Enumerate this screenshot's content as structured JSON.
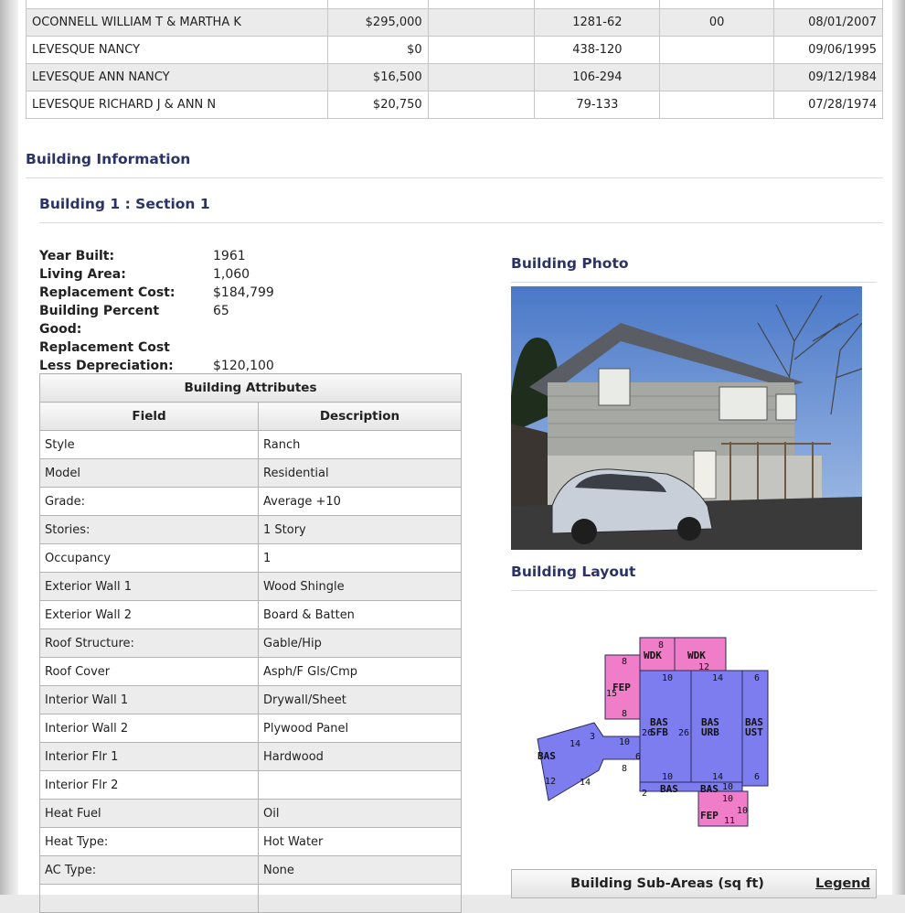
{
  "owners": {
    "rows": [
      {
        "owner": "",
        "price": "$...",
        "cert": "",
        "book_page": "",
        "instrument": "",
        "date": ""
      },
      {
        "owner": "OCONNELL WILLIAM T & MARTHA K",
        "price": "$295,000",
        "cert": "",
        "book_page": "1281-62",
        "instrument": "00",
        "date": "08/01/2007"
      },
      {
        "owner": "LEVESQUE NANCY",
        "price": "$0",
        "cert": "",
        "book_page": "438-120",
        "instrument": "",
        "date": "09/06/1995"
      },
      {
        "owner": "LEVESQUE ANN NANCY",
        "price": "$16,500",
        "cert": "",
        "book_page": "106-294",
        "instrument": "",
        "date": "09/12/1984"
      },
      {
        "owner": "LEVESQUE RICHARD J & ANN N",
        "price": "$20,750",
        "cert": "",
        "book_page": "79-133",
        "instrument": "",
        "date": "07/28/1974"
      }
    ]
  },
  "building_info": {
    "heading": "Building Information",
    "section_heading": "Building 1 : Section 1",
    "facts": [
      {
        "label": "Year Built:",
        "value": "1961"
      },
      {
        "label": "Living Area:",
        "value": "1,060"
      },
      {
        "label": "Replacement Cost:",
        "value": "$184,799"
      },
      {
        "label": "Building Percent",
        "value": "65"
      },
      {
        "label": "Good:",
        "value": ""
      },
      {
        "label": "Replacement Cost",
        "value": ""
      },
      {
        "label": "Less Depreciation:",
        "value": "$120,100"
      }
    ]
  },
  "attributes": {
    "caption": "Building Attributes",
    "col_field": "Field",
    "col_desc": "Description",
    "rows": [
      {
        "field": "Style",
        "desc": "Ranch"
      },
      {
        "field": "Model",
        "desc": "Residential"
      },
      {
        "field": "Grade:",
        "desc": "Average +10"
      },
      {
        "field": "Stories:",
        "desc": "1 Story"
      },
      {
        "field": "Occupancy",
        "desc": "1"
      },
      {
        "field": "Exterior Wall 1",
        "desc": "Wood Shingle"
      },
      {
        "field": "Exterior Wall 2",
        "desc": "Board & Batten"
      },
      {
        "field": "Roof Structure:",
        "desc": "Gable/Hip"
      },
      {
        "field": "Roof Cover",
        "desc": "Asph/F Gls/Cmp"
      },
      {
        "field": "Interior Wall 1",
        "desc": "Drywall/Sheet"
      },
      {
        "field": "Interior Wall 2",
        "desc": "Plywood Panel"
      },
      {
        "field": "Interior Flr 1",
        "desc": "Hardwood"
      },
      {
        "field": "Interior Flr 2",
        "desc": ""
      },
      {
        "field": "Heat Fuel",
        "desc": "Oil"
      },
      {
        "field": "Heat Type:",
        "desc": "Hot Water"
      },
      {
        "field": "AC Type:",
        "desc": "None"
      },
      {
        "field": "",
        "desc": ""
      }
    ]
  },
  "photo": {
    "heading": "Building Photo"
  },
  "layout": {
    "heading": "Building Layout",
    "labels": {
      "wdk": "WDK",
      "fep": "FEP",
      "bas": "BAS",
      "sfb": "SFB",
      "urb": "URB",
      "ust": "UST",
      "fep2": "FEP",
      "n8": "8",
      "n12": "12",
      "n10": "10",
      "n14": "14",
      "n6": "6",
      "n15": "15",
      "n26": "26",
      "n2": "2",
      "n11": "11",
      "n3": "3"
    },
    "colors": {
      "blue": "#7d7df0",
      "pink": "#f07dc8",
      "stroke": "#2a2a5a"
    }
  },
  "subareas": {
    "title": "Building Sub-Areas (sq ft)",
    "legend": "Legend"
  }
}
